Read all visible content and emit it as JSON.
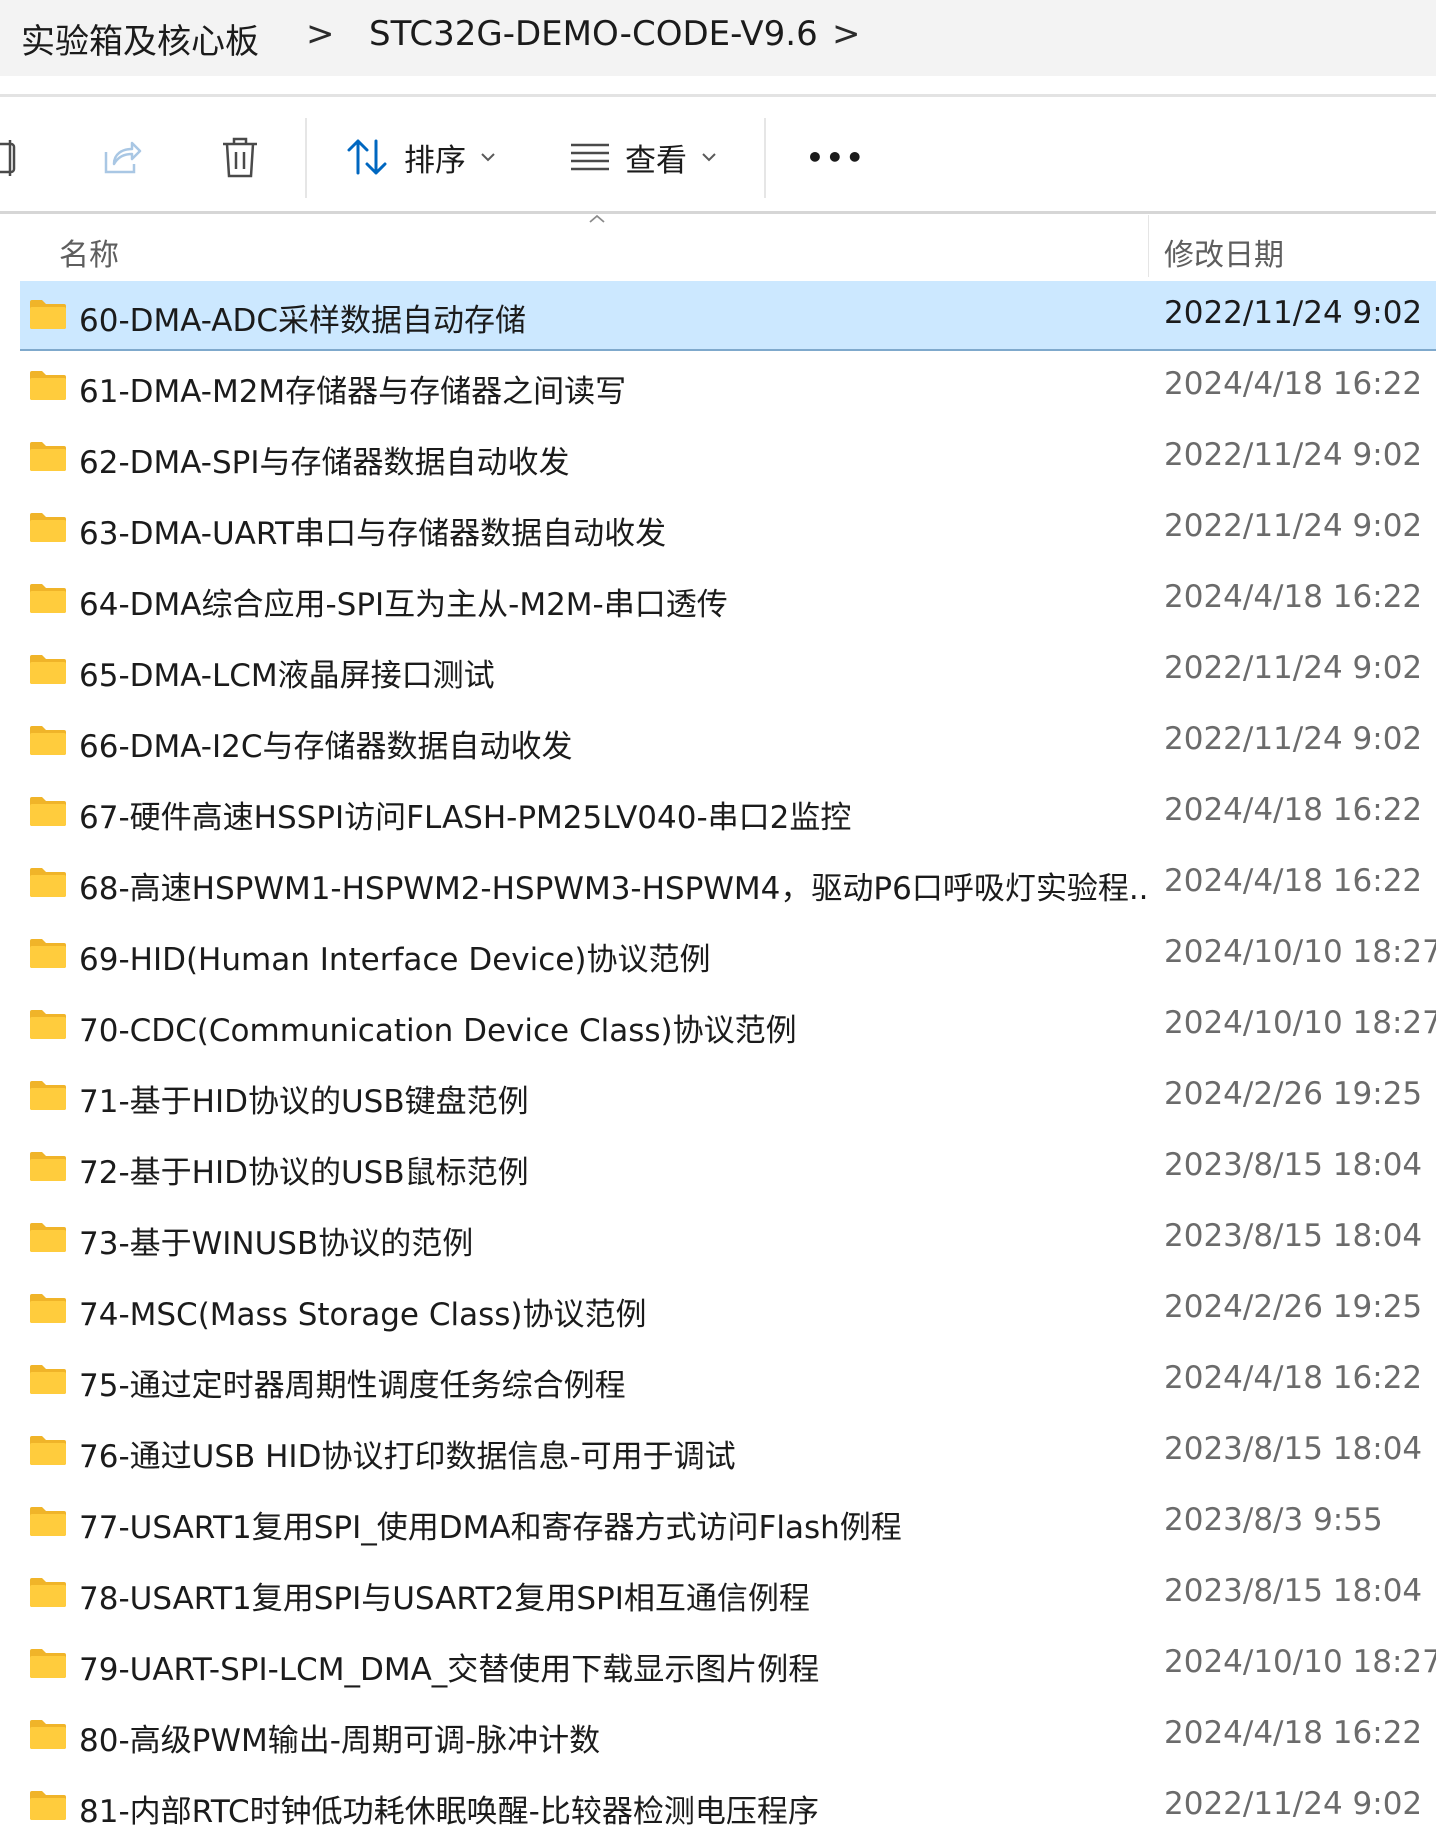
{
  "breadcrumb": {
    "items": [
      "实验箱及核心板",
      "STC32G-DEMO-CODE-V9.6"
    ],
    "separator": ">"
  },
  "toolbar": {
    "sort_label": "排序",
    "view_label": "查看",
    "more_label": "•••"
  },
  "columns": {
    "name": "名称",
    "modified": "修改日期"
  },
  "files": [
    {
      "name": "60-DMA-ADC采样数据自动存储",
      "date": "2022/11/24 9:02",
      "selected": true
    },
    {
      "name": "61-DMA-M2M存储器与存储器之间读写",
      "date": "2024/4/18 16:22"
    },
    {
      "name": "62-DMA-SPI与存储器数据自动收发",
      "date": "2022/11/24 9:02"
    },
    {
      "name": "63-DMA-UART串口与存储器数据自动收发",
      "date": "2022/11/24 9:02"
    },
    {
      "name": "64-DMA综合应用-SPI互为主从-M2M-串口透传",
      "date": "2024/4/18 16:22"
    },
    {
      "name": "65-DMA-LCM液晶屏接口测试",
      "date": "2022/11/24 9:02"
    },
    {
      "name": "66-DMA-I2C与存储器数据自动收发",
      "date": "2022/11/24 9:02"
    },
    {
      "name": "67-硬件高速HSSPI访问FLASH-PM25LV040-串口2监控",
      "date": "2024/4/18 16:22"
    },
    {
      "name": "68-高速HSPWM1-HSPWM2-HSPWM3-HSPWM4，驱动P6口呼吸灯实验程...",
      "date": "2024/4/18 16:22"
    },
    {
      "name": "69-HID(Human Interface Device)协议范例",
      "date": "2024/10/10 18:27"
    },
    {
      "name": "70-CDC(Communication Device Class)协议范例",
      "date": "2024/10/10 18:27"
    },
    {
      "name": "71-基于HID协议的USB键盘范例",
      "date": "2024/2/26 19:25"
    },
    {
      "name": "72-基于HID协议的USB鼠标范例",
      "date": "2023/8/15 18:04"
    },
    {
      "name": "73-基于WINUSB协议的范例",
      "date": "2023/8/15 18:04"
    },
    {
      "name": "74-MSC(Mass Storage Class)协议范例",
      "date": "2024/2/26 19:25"
    },
    {
      "name": "75-通过定时器周期性调度任务综合例程",
      "date": "2024/4/18 16:22"
    },
    {
      "name": "76-通过USB HID协议打印数据信息-可用于调试",
      "date": "2023/8/15 18:04"
    },
    {
      "name": "77-USART1复用SPI_使用DMA和寄存器方式访问Flash例程",
      "date": "2023/8/3 9:55"
    },
    {
      "name": "78-USART1复用SPI与USART2复用SPI相互通信例程",
      "date": "2023/8/15 18:04"
    },
    {
      "name": "79-UART-SPI-LCM_DMA_交替使用下载显示图片例程",
      "date": "2024/10/10 18:27"
    },
    {
      "name": "80-高级PWM输出-周期可调-脉冲计数",
      "date": "2024/4/18 16:22"
    },
    {
      "name": "81-内部RTC时钟低功耗休眠唤醒-比较器检测电压程序",
      "date": "2022/11/24 9:02"
    }
  ],
  "colors": {
    "folder": "#ffcc3d",
    "selected_bg": "#cce8ff",
    "accent": "#0067c0"
  }
}
